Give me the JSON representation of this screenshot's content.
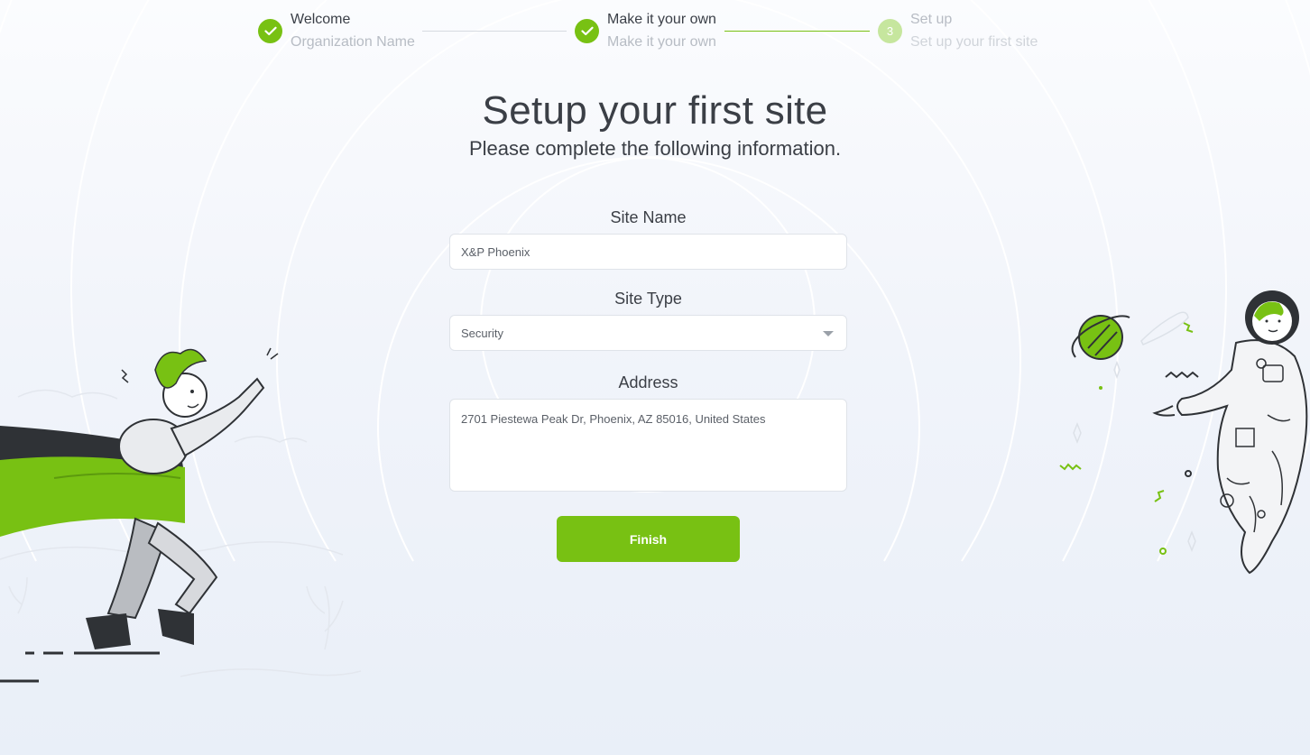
{
  "colors": {
    "accent": "#78c113",
    "accent_light": "#c6e69e",
    "text_dark": "#3b3f46",
    "text_muted": "#b7bcc4"
  },
  "stepper": {
    "steps": [
      {
        "title": "Welcome",
        "subtitle": "Organization Name",
        "status": "complete",
        "icon": "check-icon"
      },
      {
        "title": "Make it your own",
        "subtitle": "Make it your own",
        "status": "complete",
        "icon": "check-icon"
      },
      {
        "number": "3",
        "title": "Set up",
        "subtitle": "Set up your first site",
        "status": "pending"
      }
    ]
  },
  "page": {
    "title": "Setup your first site",
    "subtitle": "Please complete the following information."
  },
  "form": {
    "site_name": {
      "label": "Site Name",
      "value": "X&P Phoenix"
    },
    "site_type": {
      "label": "Site Type",
      "value": "Security",
      "icon": "chevron-down-icon"
    },
    "address": {
      "label": "Address",
      "value": "2701 Piestewa Peak Dr, Phoenix, AZ 85016, United States"
    },
    "finish_label": "Finish"
  },
  "illustrations": {
    "left": "runner-with-green-cape-illustration",
    "right": "astronaut-with-planet-illustration"
  }
}
